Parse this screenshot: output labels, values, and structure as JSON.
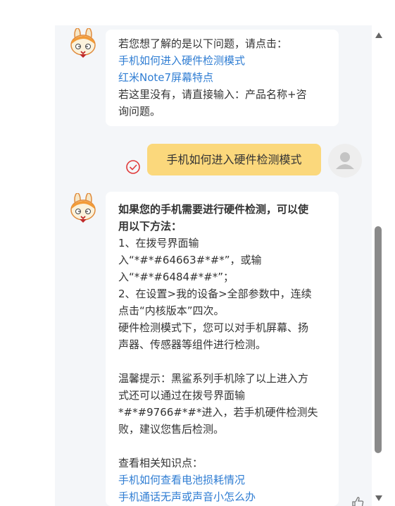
{
  "messages": {
    "bot_first": {
      "lines": {
        "intro": "若您想了解的是以下问题，请点击：",
        "link1": "手机如何进入硬件检测模式",
        "link2": "红米Note7屏幕特点",
        "hint_a": "若这里没有，请直接输入：产品名称+咨",
        "hint_b": "询问题。"
      }
    },
    "user": {
      "text": "手机如何进入硬件检测模式"
    },
    "bot_second": {
      "lines": {
        "l1": "如果您的手机需要进行硬件检测，可以使",
        "l2": "用以下方法：",
        "l3": "1、在拨号界面输",
        "l4": "入“*#*#64663#*#*”，或输",
        "l5": "入“*#*#6484#*#*”；",
        "l6": "2、在设置>我的设备>全部参数中，连续",
        "l7": "点击“内核版本”四次。",
        "l8": "硬件检测模式下，您可以对手机屏幕、扬",
        "l9": "声器、传感器等组件进行检测。",
        "l10": "温馨提示：黑鲨系列手机除了以上进入方",
        "l11": "式还可以通过在拨号界面输",
        "l12": "*#*#9766#*#*进入，若手机硬件检测失",
        "l13": "败，建议您售后检测。",
        "l14": "查看相关知识点：",
        "link1": "手机如何查看电池损耗情况",
        "link2": "手机通话无声或声音小怎么办"
      }
    }
  },
  "icons": {
    "bot_avatar": "mitu-bunny-icon",
    "user_avatar": "default-user-icon",
    "sent_status": "check-circle-icon",
    "scroll_up": "scroll-up-arrow-icon",
    "scroll_down": "scroll-down-arrow-icon",
    "like": "thumbs-up-icon"
  },
  "colors": {
    "panel_bg": "#f4f6f9",
    "user_bubble": "#fbd87c",
    "link": "#2f7dd3",
    "status_red": "#e03a3a"
  }
}
